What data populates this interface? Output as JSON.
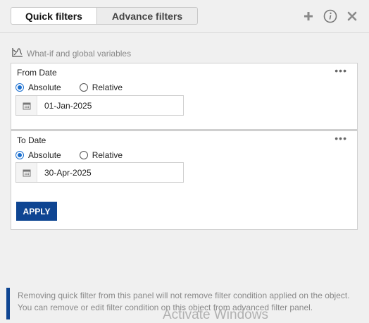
{
  "tabs": [
    {
      "label": "Quick filters"
    },
    {
      "label": "Advance filters"
    }
  ],
  "header_icons": [
    "plus-icon",
    "info-icon",
    "close-icon"
  ],
  "whatif": {
    "label": "What-if and global variables"
  },
  "filters": [
    {
      "title": "From Date",
      "options": [
        "Absolute",
        "Relative"
      ],
      "selected": "Absolute",
      "value": "01-Jan-2025"
    },
    {
      "title": "To Date",
      "options": [
        "Absolute",
        "Relative"
      ],
      "selected": "Absolute",
      "value": "30-Apr-2025"
    }
  ],
  "apply_label": "APPLY",
  "note": {
    "line1": "Removing quick filter from this panel will not remove filter condition applied on the object.",
    "line2": "You can remove or edit filter condition on this object from advanced filter panel."
  },
  "watermark": "Activate Windows",
  "colors": {
    "accent": "#0e4592",
    "radio": "#1a6fd0"
  }
}
